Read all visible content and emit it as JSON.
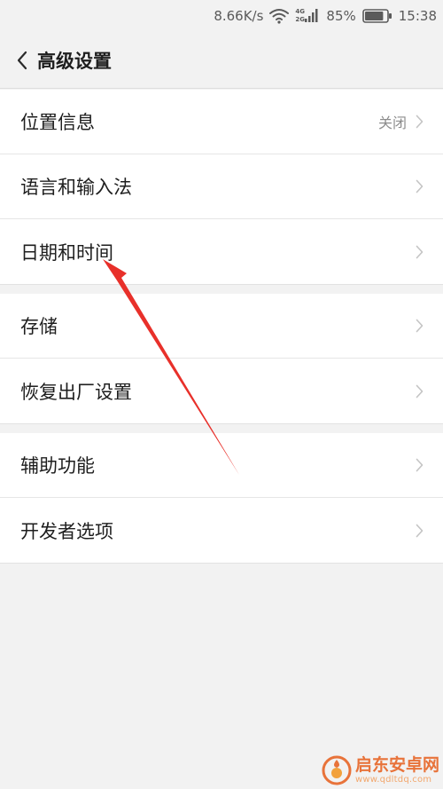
{
  "status_bar": {
    "net_speed": "8.66K/s",
    "network_tag_top": "4G",
    "network_tag_bottom": "2G",
    "battery_percent": "85%",
    "time": "15:38",
    "battery_level": 0.85,
    "icons": [
      "wifi-icon",
      "signal-icon",
      "battery-icon"
    ]
  },
  "header": {
    "title": "高级设置",
    "back_icon": "chevron-left-icon"
  },
  "settings": {
    "groups": [
      {
        "items": [
          {
            "label": "位置信息",
            "value": "关闭"
          },
          {
            "label": "语言和输入法"
          },
          {
            "label": "日期和时间"
          }
        ]
      },
      {
        "items": [
          {
            "label": "存储"
          },
          {
            "label": "恢复出厂设置"
          }
        ]
      },
      {
        "items": [
          {
            "label": "辅助功能"
          },
          {
            "label": "开发者选项"
          }
        ]
      }
    ]
  },
  "annotation": {
    "color": "#e8302a"
  },
  "watermark": {
    "name": "启东安卓网",
    "url": "www.qdltdq.com"
  },
  "colors": {
    "background": "#f2f2f2",
    "card": "#ffffff",
    "text": "#1e1e1e",
    "secondary_text": "#8c8c8c",
    "chevron": "#c4c4c4",
    "watermark": "#e8733a"
  }
}
